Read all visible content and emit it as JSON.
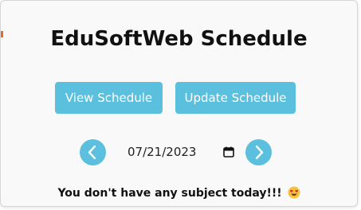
{
  "header": {
    "title": "EduSoftWeb Schedule"
  },
  "actions": {
    "view_label": "View Schedule",
    "update_label": "Update Schedule"
  },
  "date_picker": {
    "value": "07/21/2023",
    "prev_icon": "chevron-left-icon",
    "next_icon": "chevron-right-icon",
    "calendar_icon": "calendar-icon"
  },
  "status": {
    "message": "You don't have any subject today!!!",
    "emoji_icon": "heart-eyes-emoji-icon"
  },
  "colors": {
    "accent": "#5bc0de",
    "text": "#111111",
    "background": "#f9f9fa"
  }
}
